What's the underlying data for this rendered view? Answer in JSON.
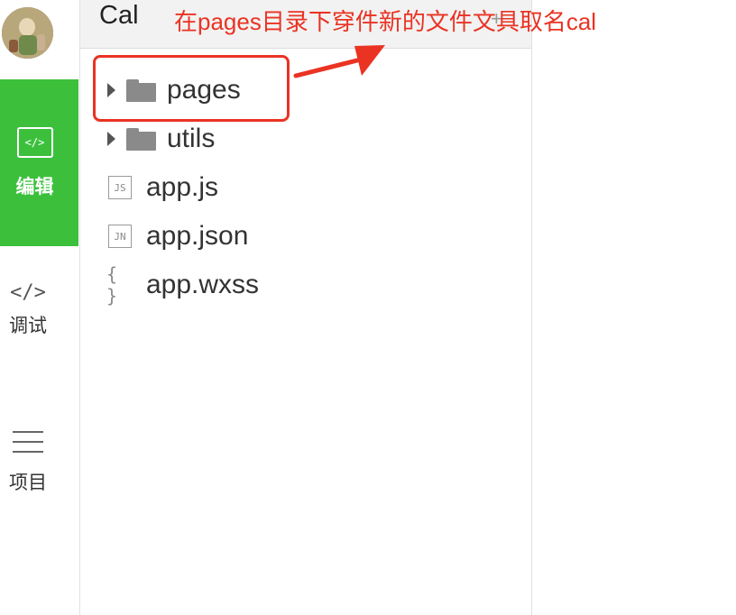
{
  "sidebar": {
    "avatar_alt": "user avatar",
    "items": [
      {
        "label": "编辑",
        "icon": "code-box-icon",
        "active": true
      },
      {
        "label": "调试",
        "icon": "code-brackets-icon",
        "active": false
      },
      {
        "label": "项目",
        "icon": "menu-lines-icon",
        "active": false
      }
    ],
    "edit_icon_glyph": "</>",
    "debug_icon_glyph": "</>"
  },
  "explorer": {
    "project_title": "Cal",
    "tree": [
      {
        "name": "pages",
        "type": "folder"
      },
      {
        "name": "utils",
        "type": "folder"
      },
      {
        "name": "app.js",
        "type": "file",
        "badge": "JS"
      },
      {
        "name": "app.json",
        "type": "file",
        "badge": "JN"
      },
      {
        "name": "app.wxss",
        "type": "file",
        "badge": "{ }"
      }
    ]
  },
  "annotation": {
    "text": "在pages目录下穿件新的文件文具取名cal",
    "color": "#ea3323"
  },
  "colors": {
    "accent_green": "#3cc03c",
    "annotation_red": "#ea3323"
  }
}
